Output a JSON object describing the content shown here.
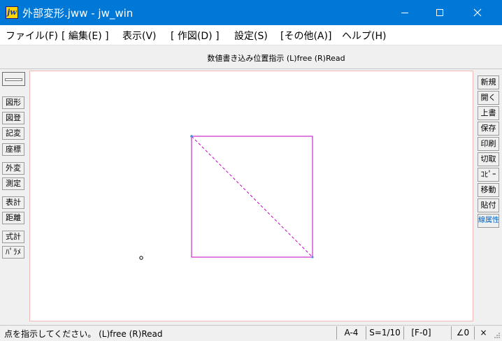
{
  "window": {
    "title": "外部変形.jww - jw_win",
    "app_icon_text": "jw",
    "accent_color": "#0078d7"
  },
  "menu": [
    {
      "label": "ファイル(F)"
    },
    {
      "label": "[ 編集(E) ]"
    },
    {
      "label": "表示(V)"
    },
    {
      "label": "[ 作図(D) ]"
    },
    {
      "label": "設定(S)"
    },
    {
      "label": "[その他(A)]"
    },
    {
      "label": "ヘルプ(H)"
    }
  ],
  "prompt": "数値書き込み位置指示 (L)free (R)Read",
  "left_tools": [
    {
      "label": "図形"
    },
    {
      "label": "図登"
    },
    {
      "label": "記変"
    },
    {
      "label": "座標"
    },
    {
      "label": "外変"
    },
    {
      "label": "測定"
    },
    {
      "label": "表計"
    },
    {
      "label": "距離"
    },
    {
      "label": "式計"
    },
    {
      "label": "ﾊﾟﾗﾒ"
    }
  ],
  "right_tools": [
    {
      "label": "新規"
    },
    {
      "label": "開く"
    },
    {
      "label": "上書"
    },
    {
      "label": "保存"
    },
    {
      "label": "印刷"
    },
    {
      "label": "切取"
    },
    {
      "label": "ｺﾋﾟｰ"
    },
    {
      "label": "移動"
    },
    {
      "label": "貼付"
    },
    {
      "label": "線属性"
    }
  ],
  "drawing": {
    "line_color": "#c000c0",
    "point_color": "#4a8ad8"
  },
  "status": {
    "message": "点を指示してください。 (L)free (R)Read",
    "paper": "A-4",
    "scale": "S=1/10",
    "layer": "[F-0]",
    "angle": "∠0",
    "close": "×"
  }
}
